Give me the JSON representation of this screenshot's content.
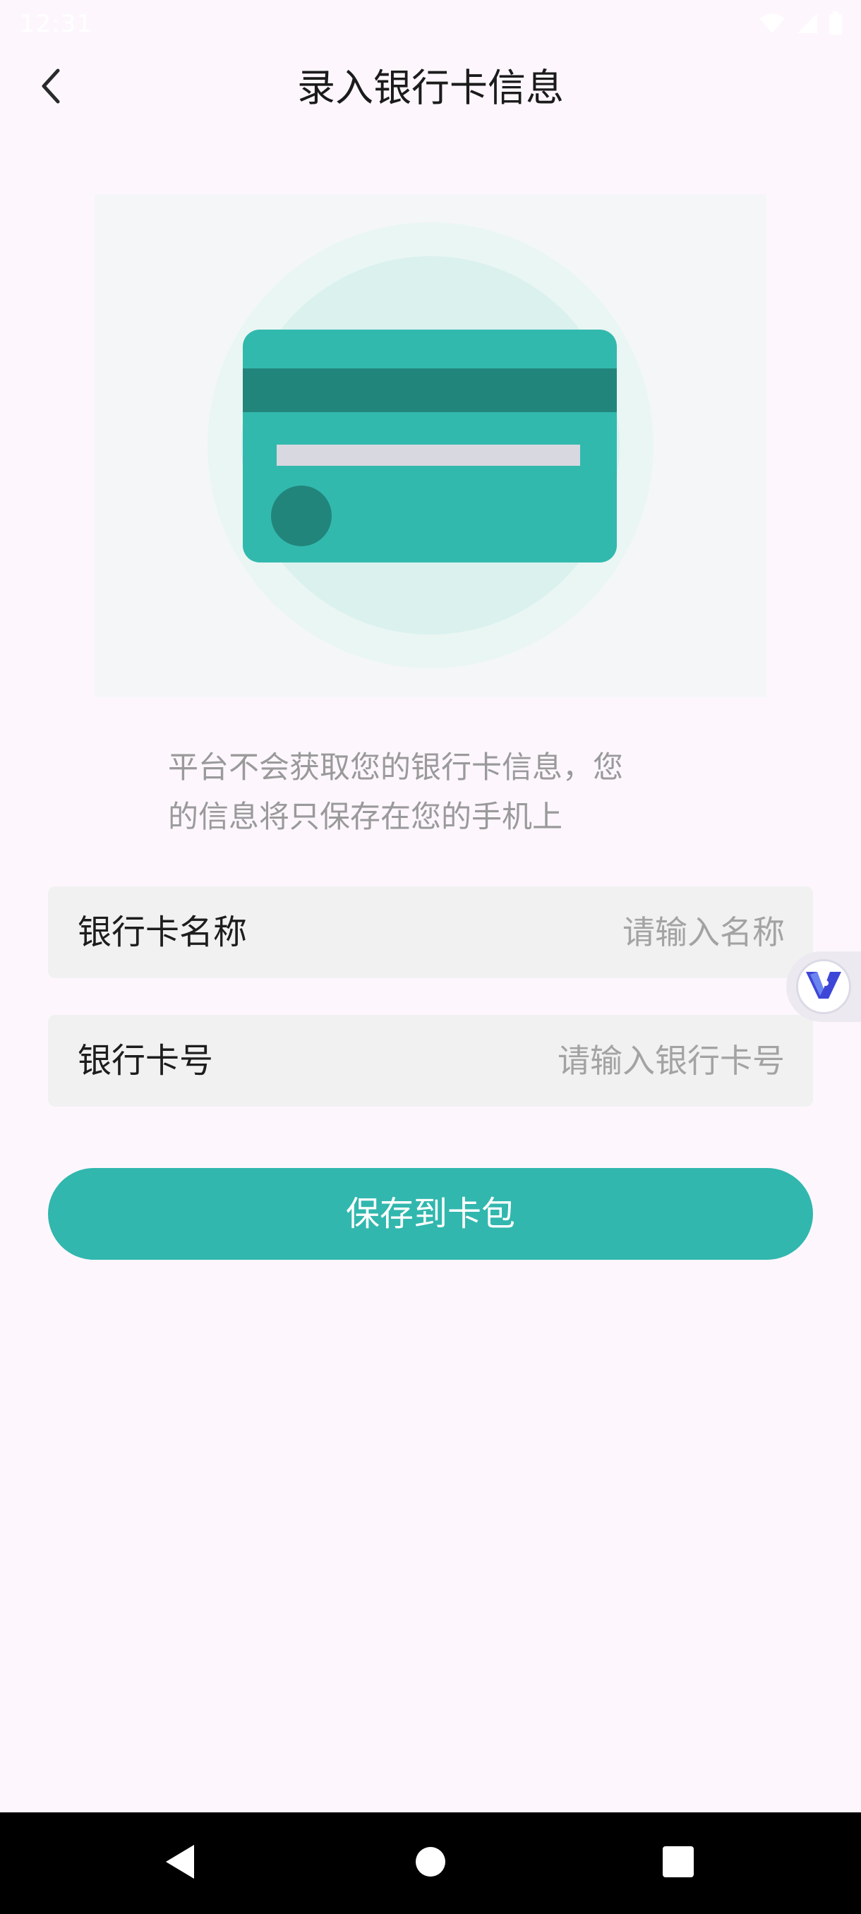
{
  "status_bar": {
    "time": "12:31",
    "icons": [
      "wifi-icon",
      "signal-icon",
      "battery-icon"
    ]
  },
  "header": {
    "back_icon": "chevron-left-icon",
    "title": "录入银行卡信息"
  },
  "illustration": {
    "icon": "credit-card-icon",
    "colors": {
      "card": "#32B9AE",
      "stripe": "#22857C",
      "chip": "#22857C",
      "bar": "#D8D8E0",
      "glow_inner": "#DAF1EE",
      "glow_outer": "#EAF6F3"
    }
  },
  "info": {
    "line1": "平台不会获取您的银行卡信息，您",
    "line2": "的信息将只保存在您的手机上"
  },
  "form": {
    "name_field": {
      "label": "银行卡名称",
      "value": "",
      "placeholder": "请输入名称"
    },
    "number_field": {
      "label": "银行卡号",
      "value": "",
      "placeholder": "请输入银行卡号"
    }
  },
  "floating_badge": {
    "icon": "v-logo-icon"
  },
  "save_button": {
    "label": "保存到卡包"
  },
  "nav_bar": {
    "back_icon": "nav-back-icon",
    "home_icon": "nav-home-icon",
    "recents_icon": "nav-recents-icon"
  },
  "colors": {
    "background": "#FDF7FD",
    "accent": "#31B7AE",
    "field_background": "#F1F1F1",
    "placeholder": "#A3A3A3",
    "info_text": "#9A9A9A"
  }
}
